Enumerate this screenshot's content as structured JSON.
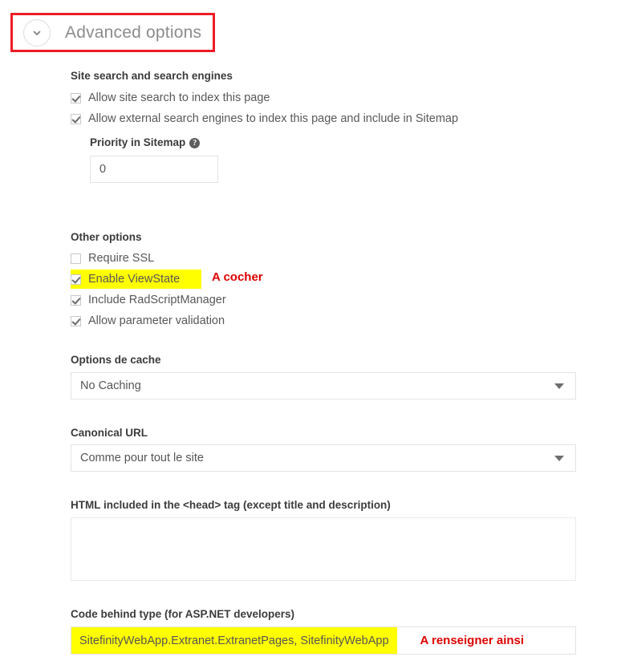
{
  "header": {
    "title": "Advanced options",
    "toggle_icon": "chevron-down-icon"
  },
  "site_search": {
    "heading": "Site search and search engines",
    "checkboxes": [
      {
        "label": "Allow site search to index this page",
        "checked": true
      },
      {
        "label": "Allow external search engines to index this page and include in Sitemap",
        "checked": true
      }
    ],
    "priority": {
      "label": "Priority in Sitemap",
      "help_icon": "help-circle-icon",
      "value": "0"
    }
  },
  "other_options": {
    "heading": "Other options",
    "checkboxes": [
      {
        "label": "Require SSL",
        "checked": false,
        "highlighted": false
      },
      {
        "label": "Enable ViewState",
        "checked": true,
        "highlighted": true
      },
      {
        "label": "Include RadScriptManager",
        "checked": true,
        "highlighted": false
      },
      {
        "label": "Allow parameter validation",
        "checked": true,
        "highlighted": false
      }
    ],
    "annotation": "A cocher"
  },
  "cache": {
    "label": "Options de cache",
    "value": "No Caching",
    "caret_icon": "caret-down-icon"
  },
  "canonical": {
    "label": "Canonical URL",
    "value": "Comme pour tout le site",
    "caret_icon": "caret-down-icon"
  },
  "head_html": {
    "label": "HTML included in the <head> tag (except title and description)",
    "value": ""
  },
  "code_behind": {
    "label": "Code behind type (for ASP.NET developers)",
    "value": "SitefinityWebApp.Extranet.ExtranetPages, SitefinityWebApp",
    "annotation": "A renseigner ainsi"
  },
  "colors": {
    "annotation_red": "#dd0000",
    "highlight_border_red": "#ee1c25",
    "highlight_yellow": "#ffff00",
    "label_text": "#3b3b3b",
    "body_text": "#585858"
  }
}
